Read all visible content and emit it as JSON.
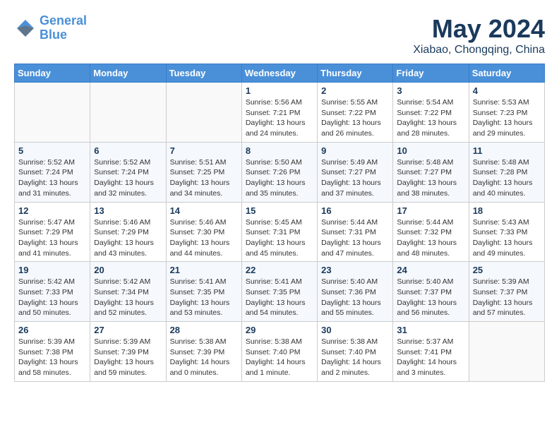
{
  "header": {
    "logo_line1": "General",
    "logo_line2": "Blue",
    "month": "May 2024",
    "location": "Xiabao, Chongqing, China"
  },
  "days_of_week": [
    "Sunday",
    "Monday",
    "Tuesday",
    "Wednesday",
    "Thursday",
    "Friday",
    "Saturday"
  ],
  "weeks": [
    [
      {
        "day": "",
        "info": ""
      },
      {
        "day": "",
        "info": ""
      },
      {
        "day": "",
        "info": ""
      },
      {
        "day": "1",
        "info": "Sunrise: 5:56 AM\nSunset: 7:21 PM\nDaylight: 13 hours\nand 24 minutes."
      },
      {
        "day": "2",
        "info": "Sunrise: 5:55 AM\nSunset: 7:22 PM\nDaylight: 13 hours\nand 26 minutes."
      },
      {
        "day": "3",
        "info": "Sunrise: 5:54 AM\nSunset: 7:22 PM\nDaylight: 13 hours\nand 28 minutes."
      },
      {
        "day": "4",
        "info": "Sunrise: 5:53 AM\nSunset: 7:23 PM\nDaylight: 13 hours\nand 29 minutes."
      }
    ],
    [
      {
        "day": "5",
        "info": "Sunrise: 5:52 AM\nSunset: 7:24 PM\nDaylight: 13 hours\nand 31 minutes."
      },
      {
        "day": "6",
        "info": "Sunrise: 5:52 AM\nSunset: 7:24 PM\nDaylight: 13 hours\nand 32 minutes."
      },
      {
        "day": "7",
        "info": "Sunrise: 5:51 AM\nSunset: 7:25 PM\nDaylight: 13 hours\nand 34 minutes."
      },
      {
        "day": "8",
        "info": "Sunrise: 5:50 AM\nSunset: 7:26 PM\nDaylight: 13 hours\nand 35 minutes."
      },
      {
        "day": "9",
        "info": "Sunrise: 5:49 AM\nSunset: 7:27 PM\nDaylight: 13 hours\nand 37 minutes."
      },
      {
        "day": "10",
        "info": "Sunrise: 5:48 AM\nSunset: 7:27 PM\nDaylight: 13 hours\nand 38 minutes."
      },
      {
        "day": "11",
        "info": "Sunrise: 5:48 AM\nSunset: 7:28 PM\nDaylight: 13 hours\nand 40 minutes."
      }
    ],
    [
      {
        "day": "12",
        "info": "Sunrise: 5:47 AM\nSunset: 7:29 PM\nDaylight: 13 hours\nand 41 minutes."
      },
      {
        "day": "13",
        "info": "Sunrise: 5:46 AM\nSunset: 7:29 PM\nDaylight: 13 hours\nand 43 minutes."
      },
      {
        "day": "14",
        "info": "Sunrise: 5:46 AM\nSunset: 7:30 PM\nDaylight: 13 hours\nand 44 minutes."
      },
      {
        "day": "15",
        "info": "Sunrise: 5:45 AM\nSunset: 7:31 PM\nDaylight: 13 hours\nand 45 minutes."
      },
      {
        "day": "16",
        "info": "Sunrise: 5:44 AM\nSunset: 7:31 PM\nDaylight: 13 hours\nand 47 minutes."
      },
      {
        "day": "17",
        "info": "Sunrise: 5:44 AM\nSunset: 7:32 PM\nDaylight: 13 hours\nand 48 minutes."
      },
      {
        "day": "18",
        "info": "Sunrise: 5:43 AM\nSunset: 7:33 PM\nDaylight: 13 hours\nand 49 minutes."
      }
    ],
    [
      {
        "day": "19",
        "info": "Sunrise: 5:42 AM\nSunset: 7:33 PM\nDaylight: 13 hours\nand 50 minutes."
      },
      {
        "day": "20",
        "info": "Sunrise: 5:42 AM\nSunset: 7:34 PM\nDaylight: 13 hours\nand 52 minutes."
      },
      {
        "day": "21",
        "info": "Sunrise: 5:41 AM\nSunset: 7:35 PM\nDaylight: 13 hours\nand 53 minutes."
      },
      {
        "day": "22",
        "info": "Sunrise: 5:41 AM\nSunset: 7:35 PM\nDaylight: 13 hours\nand 54 minutes."
      },
      {
        "day": "23",
        "info": "Sunrise: 5:40 AM\nSunset: 7:36 PM\nDaylight: 13 hours\nand 55 minutes."
      },
      {
        "day": "24",
        "info": "Sunrise: 5:40 AM\nSunset: 7:37 PM\nDaylight: 13 hours\nand 56 minutes."
      },
      {
        "day": "25",
        "info": "Sunrise: 5:39 AM\nSunset: 7:37 PM\nDaylight: 13 hours\nand 57 minutes."
      }
    ],
    [
      {
        "day": "26",
        "info": "Sunrise: 5:39 AM\nSunset: 7:38 PM\nDaylight: 13 hours\nand 58 minutes."
      },
      {
        "day": "27",
        "info": "Sunrise: 5:39 AM\nSunset: 7:39 PM\nDaylight: 13 hours\nand 59 minutes."
      },
      {
        "day": "28",
        "info": "Sunrise: 5:38 AM\nSunset: 7:39 PM\nDaylight: 14 hours\nand 0 minutes."
      },
      {
        "day": "29",
        "info": "Sunrise: 5:38 AM\nSunset: 7:40 PM\nDaylight: 14 hours\nand 1 minute."
      },
      {
        "day": "30",
        "info": "Sunrise: 5:38 AM\nSunset: 7:40 PM\nDaylight: 14 hours\nand 2 minutes."
      },
      {
        "day": "31",
        "info": "Sunrise: 5:37 AM\nSunset: 7:41 PM\nDaylight: 14 hours\nand 3 minutes."
      },
      {
        "day": "",
        "info": ""
      }
    ]
  ]
}
